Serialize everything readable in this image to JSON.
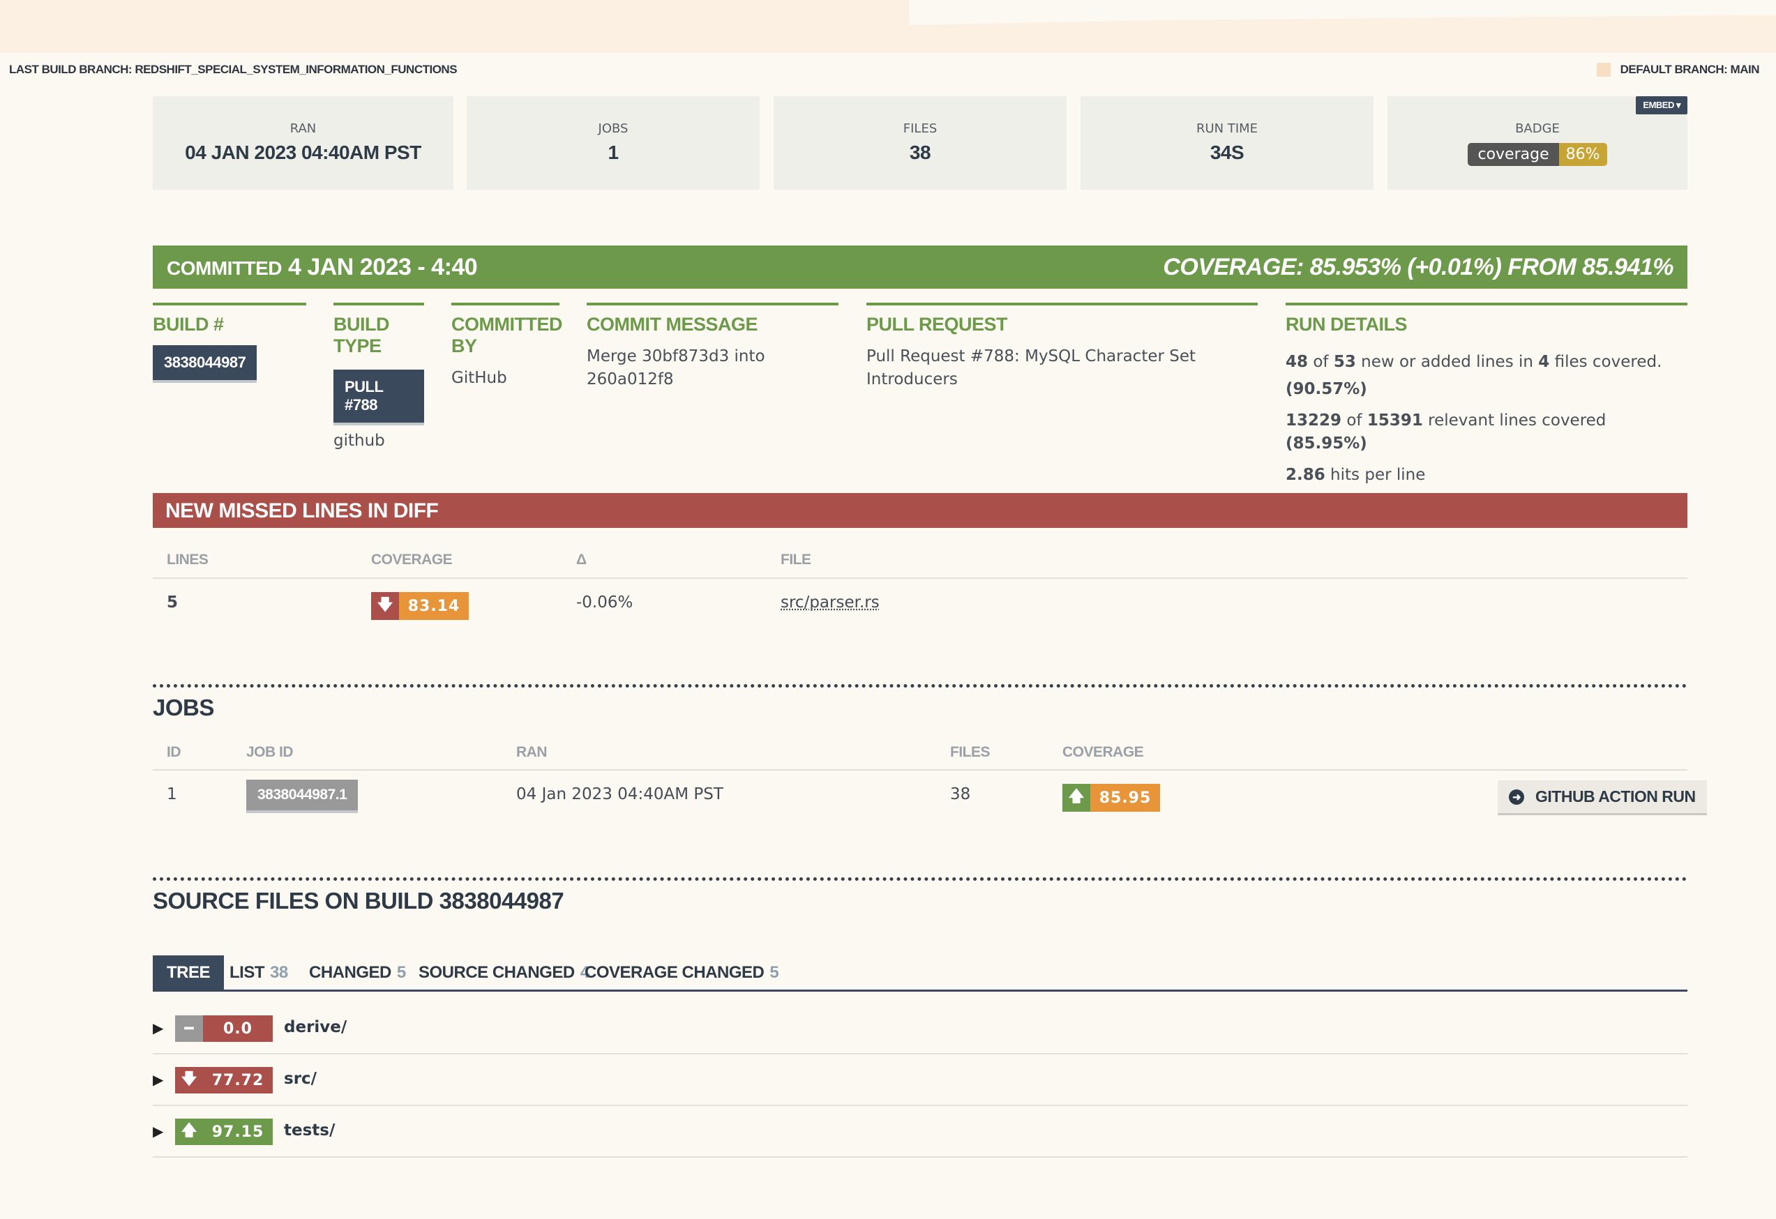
{
  "branches": {
    "last_build": "LAST BUILD BRANCH: REDSHIFT_SPECIAL_SYSTEM_INFORMATION_FUNCTIONS",
    "default": "DEFAULT BRANCH: MAIN"
  },
  "stats": {
    "ran_label": "RAN",
    "ran_value": "04 JAN 2023 04:40AM PST",
    "jobs_label": "JOBS",
    "jobs_value": "1",
    "files_label": "FILES",
    "files_value": "38",
    "runtime_label": "RUN TIME",
    "runtime_value": "34S",
    "badge_label": "BADGE",
    "badge_left": "coverage",
    "badge_right": "86%",
    "embed_label": "EMBED ▾"
  },
  "commit": {
    "committed_small": "COMMITTED",
    "committed_date": "4 JAN 2023 - 4:40",
    "coverage_summary": "COVERAGE: 85.953% (+0.01%) FROM 85.941%",
    "build_num_h": "BUILD #",
    "build_num": "3838044987",
    "build_type_h": "BUILD TYPE",
    "build_type": "PULL #788",
    "build_type_sub": "github",
    "committed_by_h": "COMMITTED BY",
    "committed_by": "GitHub",
    "message_h": "COMMIT MESSAGE",
    "message_1": "Merge 30bf873d3 into",
    "message_2": "260a012f8",
    "pr_h": "PULL REQUEST",
    "pr_1": "Pull Request #788: MySQL Character Set",
    "pr_2": "Introducers",
    "run_h": "RUN DETAILS",
    "run_1a": "48",
    "run_1b": " of ",
    "run_1c": "53",
    "run_1d": " new or added lines in ",
    "run_1e": "4",
    "run_1f": " files covered.",
    "run_2": "(90.57%)",
    "run_3a": "13229",
    "run_3b": " of ",
    "run_3c": "15391",
    "run_3d": " relevant lines covered ",
    "run_3e": "(85.95%)",
    "run_4a": "2.86",
    "run_4b": " hits per line"
  },
  "missed": {
    "title": "NEW MISSED LINES IN DIFF",
    "headers": [
      "LINES",
      "COVERAGE",
      "Δ",
      "FILE"
    ],
    "row": {
      "lines": "5",
      "coverage": "83.14",
      "delta": "-0.06%",
      "file": "src/parser.rs"
    }
  },
  "jobs": {
    "title": "JOBS",
    "headers": [
      "ID",
      "JOB ID",
      "RAN",
      "FILES",
      "COVERAGE"
    ],
    "row": {
      "id": "1",
      "job_id": "3838044987.1",
      "ran": "04 Jan 2023 04:40AM PST",
      "files": "38",
      "coverage": "85.95"
    },
    "action_label": "GITHUB ACTION RUN"
  },
  "source": {
    "title": "SOURCE FILES ON BUILD 3838044987",
    "tabs": [
      {
        "label": "TREE",
        "count": ""
      },
      {
        "label": "LIST",
        "count": "38"
      },
      {
        "label": "CHANGED",
        "count": "5"
      },
      {
        "label": "SOURCE CHANGED",
        "count": "4"
      },
      {
        "label": "COVERAGE CHANGED",
        "count": "5"
      }
    ],
    "tree": [
      {
        "name": "derive/",
        "coverage": "0.0",
        "trend": "none"
      },
      {
        "name": "src/",
        "coverage": "77.72",
        "trend": "down"
      },
      {
        "name": "tests/",
        "coverage": "97.15",
        "trend": "up"
      }
    ]
  },
  "colors": {
    "green": "#6c9a4a",
    "red": "#ab4f4a",
    "orange": "#e8953a",
    "navy": "#3a4a5c",
    "gray": "#999999"
  }
}
